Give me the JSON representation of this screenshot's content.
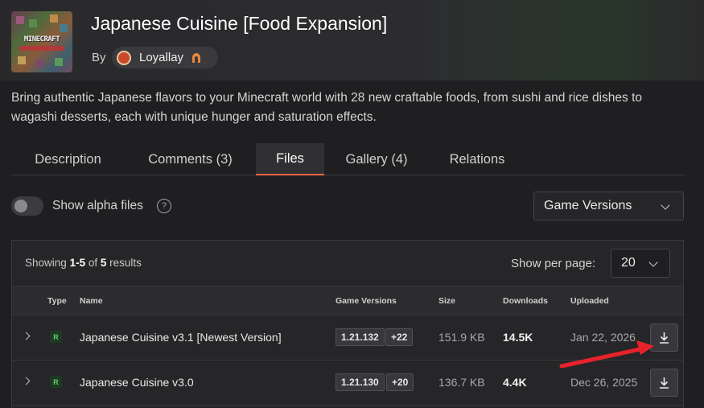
{
  "project": {
    "title": "Japanese Cuisine [Food Expansion]",
    "by_label": "By",
    "author": "Loyallay",
    "thumb_text": "MINECRAFT",
    "summary": "Bring authentic Japanese flavors to your Minecraft world with 28 new craftable foods, from sushi and rice dishes to wagashi desserts, each with unique hunger and saturation effects."
  },
  "tabs": [
    {
      "label": "Description",
      "active": false
    },
    {
      "label": "Comments (3)",
      "active": false
    },
    {
      "label": "Files",
      "active": true
    },
    {
      "label": "Gallery (4)",
      "active": false
    },
    {
      "label": "Relations",
      "active": false
    }
  ],
  "filters": {
    "alpha_label": "Show alpha files",
    "alpha_enabled": false,
    "help_glyph": "?",
    "game_versions_label": "Game Versions"
  },
  "results": {
    "showing_prefix": "Showing",
    "range": "1-5",
    "of_text": "of",
    "total": "5",
    "suffix": "results",
    "per_page_label": "Show per page:",
    "per_page_value": "20"
  },
  "table": {
    "headers": {
      "type": "Type",
      "name": "Name",
      "game_versions": "Game Versions",
      "size": "Size",
      "downloads": "Downloads",
      "uploaded": "Uploaded"
    },
    "rows": [
      {
        "type": "R",
        "name": "Japanese Cuisine v3.1 [Newest Version]",
        "version": "1.21.132",
        "extra_versions": "+22",
        "size": "151.9 KB",
        "downloads": "14.5K",
        "uploaded": "Jan 22, 2026"
      },
      {
        "type": "R",
        "name": "Japanese Cuisine v3.0",
        "version": "1.21.130",
        "extra_versions": "+20",
        "size": "136.7 KB",
        "downloads": "4.4K",
        "uploaded": "Dec 26, 2025"
      }
    ]
  },
  "colors": {
    "accent": "#e8663d",
    "release_badge": "#5fcf6f",
    "annotation_arrow": "#e8222a"
  }
}
